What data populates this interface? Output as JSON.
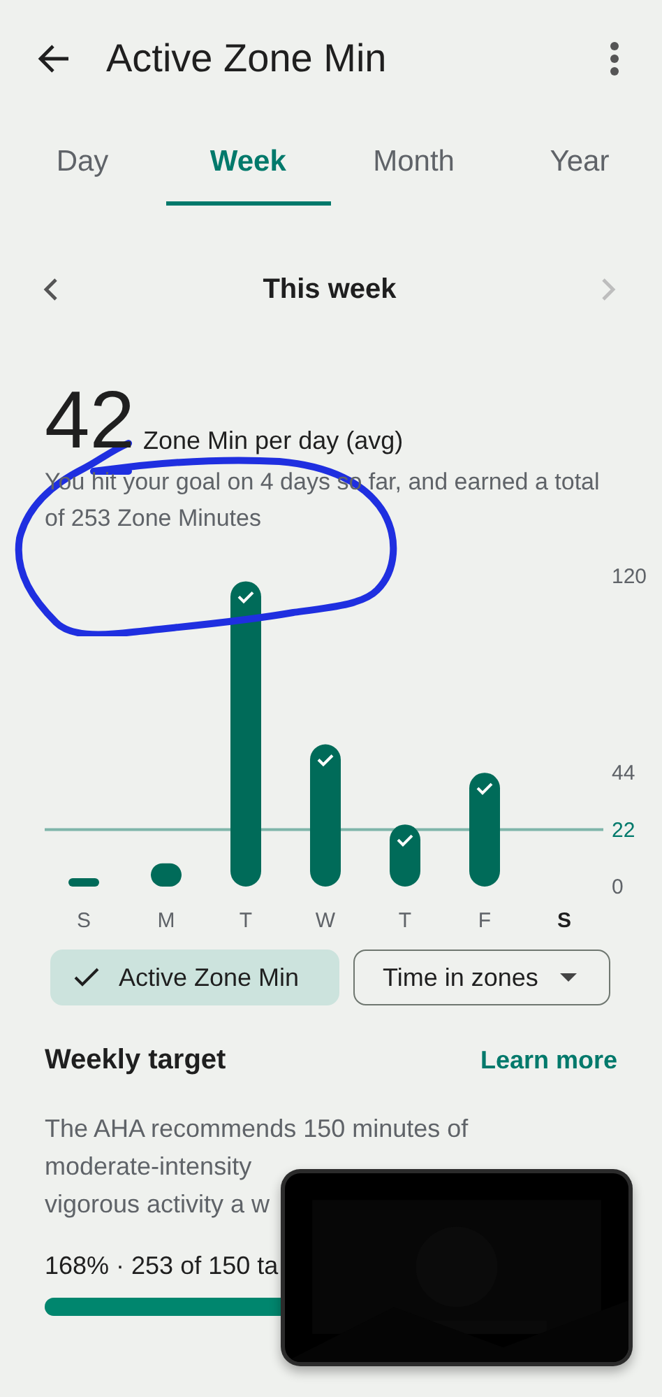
{
  "header": {
    "title": "Active Zone Min"
  },
  "tabs": [
    {
      "label": "Day",
      "selected": false
    },
    {
      "label": "Week",
      "selected": true
    },
    {
      "label": "Month",
      "selected": false
    },
    {
      "label": "Year",
      "selected": false
    }
  ],
  "period": {
    "label": "This week",
    "next_disabled": true
  },
  "summary": {
    "value": "42",
    "unit": "Zone Min per day (avg)",
    "description": "You hit your goal on 4 days so far, and earned a total of 253 Zone Minutes"
  },
  "chart": {
    "chart_data": {
      "type": "bar",
      "categories": [
        "S",
        "M",
        "T",
        "W",
        "T",
        "F",
        "S"
      ],
      "values": [
        3,
        9,
        118,
        55,
        24,
        44,
        null
      ],
      "ylim": [
        0,
        120
      ],
      "yticks": [
        0,
        22,
        44,
        120
      ],
      "ref_lines": [
        {
          "axis": "y",
          "value": 22
        }
      ]
    },
    "days": [
      {
        "today": false,
        "goal_met": false
      },
      {
        "today": false,
        "goal_met": false
      },
      {
        "today": false,
        "goal_met": true
      },
      {
        "today": false,
        "goal_met": true
      },
      {
        "today": false,
        "goal_met": true
      },
      {
        "today": false,
        "goal_met": true
      },
      {
        "today": true,
        "goal_met": false
      }
    ]
  },
  "chips": [
    {
      "kind": "toggle",
      "label": "Active Zone Min",
      "selected": true
    },
    {
      "kind": "dropdown",
      "label": "Time in zones",
      "selected": false
    }
  ],
  "weekly_target": {
    "title": "Weekly target",
    "link": "Learn more",
    "lines": [
      "The AHA recommends 150 minutes of",
      "moderate-intensity",
      "vigorous activity a w"
    ],
    "progress_text": "168% · 253 of 150 ta",
    "level": 1
  }
}
